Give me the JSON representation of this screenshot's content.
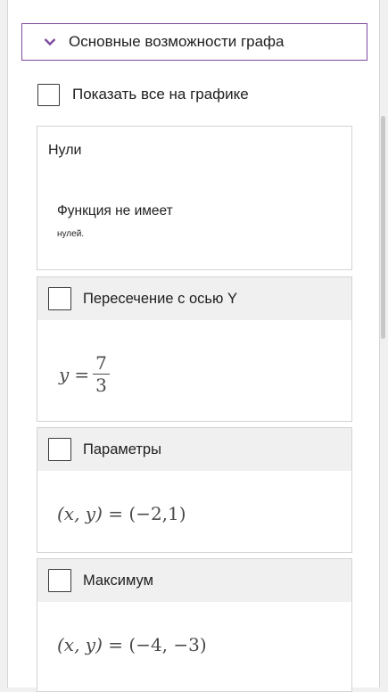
{
  "panel": {
    "header_title": "Основные возможности графа",
    "show_all_label": "Показать все на графике"
  },
  "zeros": {
    "title": "Нули",
    "text_line1": "Функция не имеет",
    "text_line2": "нулей."
  },
  "y_intercept": {
    "label": "Пересечение с осью Y",
    "var": "y",
    "eq": "=",
    "numerator": "7",
    "denominator": "3"
  },
  "parameters": {
    "label": "Параметры",
    "lhs": "(x, y)",
    "eq": "=",
    "rhs": "(−2,1)"
  },
  "maximum": {
    "label": "Максимум",
    "lhs": "(x, y)",
    "eq": "=",
    "rhs": "(−4, −3)"
  },
  "colors": {
    "accent": "#7e4a9e",
    "card_header_bg": "#f0f0f0",
    "border": "#d3d3d3"
  },
  "icons": {
    "header": "chevron-down-icon"
  }
}
